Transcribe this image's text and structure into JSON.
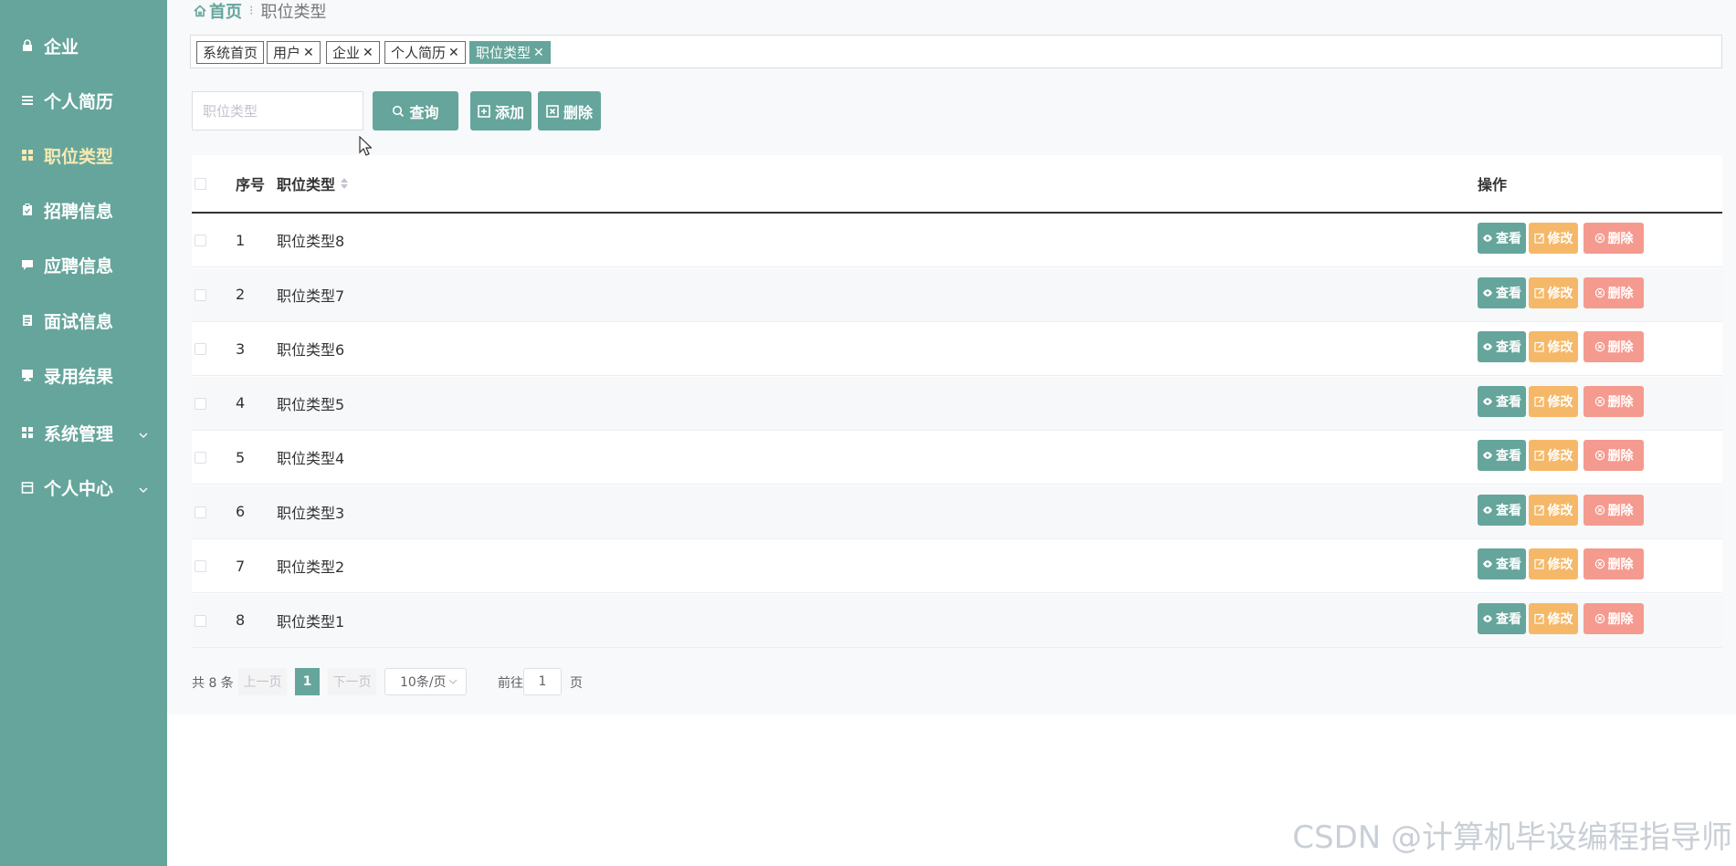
{
  "sidebar": {
    "items": [
      {
        "label": "企业",
        "icon": "lock-icon"
      },
      {
        "label": "个人简历",
        "icon": "list-icon"
      },
      {
        "label": "职位类型",
        "icon": "grid-icon"
      },
      {
        "label": "招聘信息",
        "icon": "clipboard-icon"
      },
      {
        "label": "应聘信息",
        "icon": "comment-icon"
      },
      {
        "label": "面试信息",
        "icon": "document-icon"
      },
      {
        "label": "录用结果",
        "icon": "monitor-icon"
      },
      {
        "label": "系统管理",
        "icon": "grid-icon"
      },
      {
        "label": "个人中心",
        "icon": "calendar-icon"
      }
    ],
    "active_index": 2,
    "colors": {
      "background": "#65a59b",
      "active_text": "#f6e9b3"
    }
  },
  "breadcrumb": {
    "home": "首页",
    "current": "职位类型"
  },
  "tabs": [
    {
      "label": "系统首页",
      "closable": false
    },
    {
      "label": "用户",
      "closable": true
    },
    {
      "label": "企业",
      "closable": true
    },
    {
      "label": "个人简历",
      "closable": true
    },
    {
      "label": "职位类型",
      "closable": true,
      "active": true
    }
  ],
  "toolbar": {
    "search_placeholder": "职位类型",
    "search_value": "",
    "query_label": "查询",
    "add_label": "添加",
    "delete_label": "删除"
  },
  "table": {
    "headers": {
      "index": "序号",
      "type": "职位类型",
      "ops": "操作"
    },
    "rows": [
      {
        "index": "1",
        "type": "职位类型8"
      },
      {
        "index": "2",
        "type": "职位类型7"
      },
      {
        "index": "3",
        "type": "职位类型6"
      },
      {
        "index": "4",
        "type": "职位类型5"
      },
      {
        "index": "5",
        "type": "职位类型4"
      },
      {
        "index": "6",
        "type": "职位类型3"
      },
      {
        "index": "7",
        "type": "职位类型2"
      },
      {
        "index": "8",
        "type": "职位类型1"
      }
    ],
    "row_ops": {
      "view": "查看",
      "edit": "修改",
      "delete": "删除"
    },
    "colors": {
      "view": "#65a59b",
      "edit": "#f5b868",
      "delete": "#f59a8f"
    }
  },
  "pager": {
    "total": "共 8 条",
    "prev": "上一页",
    "current": "1",
    "next": "下一页",
    "page_size": "10条/页",
    "goto_label": "前往",
    "goto_value": "1",
    "page_suffix": "页"
  },
  "watermark": "CSDN @计算机毕设编程指导师"
}
